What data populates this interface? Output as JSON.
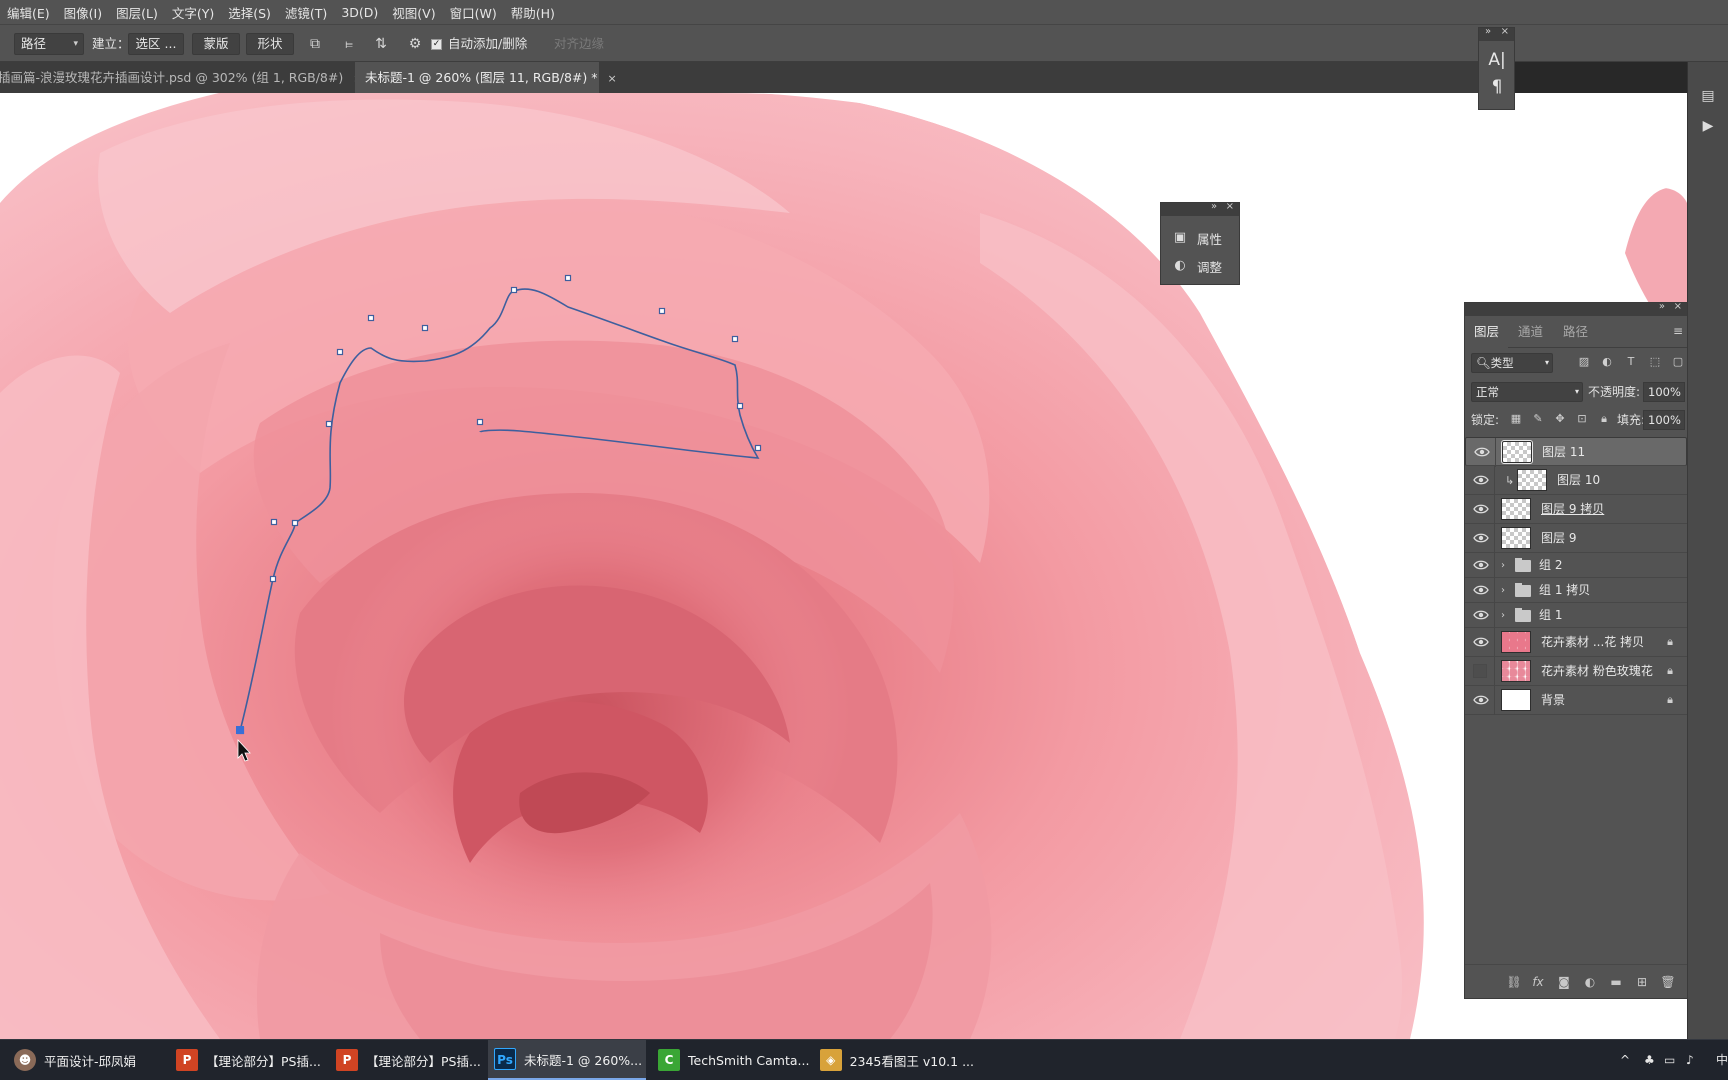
{
  "menu": [
    "编辑(E)",
    "图像(I)",
    "图层(L)",
    "文字(Y)",
    "选择(S)",
    "滤镜(T)",
    "3D(D)",
    "视图(V)",
    "窗口(W)",
    "帮助(H)"
  ],
  "options": {
    "mode_select": "路径",
    "build_label": "建立：",
    "selection_btn": "选区 ...",
    "mask_btn": "蒙版",
    "shape_btn": "形状",
    "auto_add_delete": "自动添加/删除",
    "align_edges": "对齐边缘"
  },
  "tabs": [
    {
      "label": "插画篇-浪漫玫瑰花卉插画设计.psd @ 302% (组 1, RGB/8#)",
      "close": "×"
    },
    {
      "label": "未标题-1 @ 260% (图层 11, RGB/8#) *",
      "close": "×"
    }
  ],
  "properties_panel": {
    "items": [
      {
        "label": "属性",
        "icon": "properties-icon"
      },
      {
        "label": "调整",
        "icon": "adjustments-icon"
      }
    ]
  },
  "layers_panel": {
    "tabs": [
      "图层",
      "通道",
      "路径"
    ],
    "filter_select": "类型",
    "blend_mode": "正常",
    "opacity_label": "不透明度:",
    "opacity_value": "100%",
    "lock_label": "锁定:",
    "fill_label": "填充:",
    "fill_value": "100%",
    "layers": [
      {
        "name": "图层 11",
        "kind": "pixel",
        "visible": true,
        "selected": true
      },
      {
        "name": "图层 10",
        "kind": "pixel-clipped",
        "visible": true
      },
      {
        "name": "图层 9 拷贝",
        "kind": "pixel",
        "visible": true
      },
      {
        "name": "图层 9",
        "kind": "pixel",
        "visible": true
      },
      {
        "name": "组 2",
        "kind": "group",
        "visible": true
      },
      {
        "name": "组 1 拷贝",
        "kind": "group",
        "visible": true
      },
      {
        "name": "组 1",
        "kind": "group",
        "visible": true
      },
      {
        "name": "花卉素材 ...花 拷贝",
        "kind": "image",
        "visible": true,
        "locked": true
      },
      {
        "name": "花卉素材 粉色玫瑰花",
        "kind": "smart",
        "visible": false,
        "locked": true
      },
      {
        "name": "背景",
        "kind": "background",
        "visible": true,
        "locked": true
      }
    ]
  },
  "taskbar": {
    "items": [
      {
        "label": "平面设计-邱凤娟",
        "icon": "user-avatar-icon",
        "color": "#8a6a58"
      },
      {
        "label": "【理论部分】PS插...",
        "icon": "powerpoint-icon",
        "color": "#d04423"
      },
      {
        "label": "【理论部分】PS插...",
        "icon": "powerpoint-icon",
        "color": "#d04423"
      },
      {
        "label": "未标题-1 @ 260%...",
        "icon": "photoshop-icon",
        "color": "#0a2a4a"
      },
      {
        "label": "TechSmith Camta...",
        "icon": "camtasia-icon",
        "color": "#3aa635"
      },
      {
        "label": "2345看图王 v10.1 ...",
        "icon": "image-viewer-icon",
        "color": "#d8a23a"
      }
    ],
    "tray_text": "中"
  },
  "colors": {
    "rose_light": "#f6b6bf",
    "rose_mid": "#ef8f98",
    "rose_dark": "#d96871",
    "path_stroke": "#3e5f9e"
  }
}
